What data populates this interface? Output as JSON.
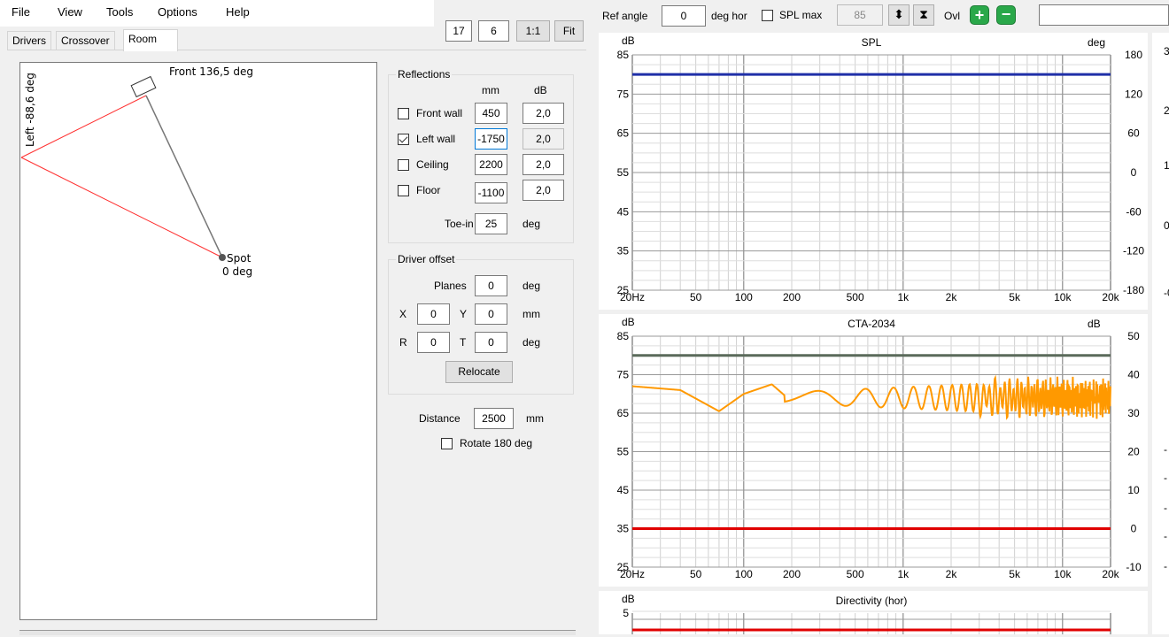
{
  "menu": [
    "File",
    "View",
    "Tools",
    "Options",
    "Help"
  ],
  "tabs": [
    "Drivers",
    "Crossover",
    "Room"
  ],
  "zoom": {
    "a": "17",
    "b": "6",
    "one_to_one": "1:1",
    "fit": "Fit"
  },
  "toolbar": {
    "ref_angle_label": "Ref angle",
    "ref_angle_value": "0",
    "deg_hor_label": "deg hor",
    "spl_max_label": "SPL max",
    "spl_max_value": "85",
    "ovl_label": "Ovl",
    "plus_icon": "plus-icon",
    "minus_icon": "minus-icon"
  },
  "room": {
    "front_label": "Front 136,5 deg",
    "left_label": "Left -88,6 deg",
    "spot_label": "Spot",
    "spot_deg": "0 deg"
  },
  "reflections": {
    "title": "Reflections",
    "col_mm": "mm",
    "col_db": "dB",
    "rows": [
      {
        "label": "Front wall",
        "checked": false,
        "mm": "450",
        "db": "2,0"
      },
      {
        "label": "Left wall",
        "checked": true,
        "mm": "-1750",
        "db": "2,0"
      },
      {
        "label": "Ceiling",
        "checked": false,
        "mm": "2200",
        "db": "2,0"
      },
      {
        "label": "Floor",
        "checked": false,
        "mm": "-1100",
        "db": "2,0"
      }
    ],
    "toe_in_label": "Toe-in",
    "toe_in_value": "25",
    "toe_in_unit": "deg"
  },
  "driver_offset": {
    "title": "Driver offset",
    "planes_label": "Planes",
    "planes_value": "0",
    "planes_unit": "deg",
    "x_label": "X",
    "x_value": "0",
    "y_label": "Y",
    "y_value": "0",
    "xy_unit": "mm",
    "r_label": "R",
    "r_value": "0",
    "t_label": "T",
    "t_value": "0",
    "rt_unit": "deg",
    "relocate_label": "Relocate"
  },
  "distance": {
    "label": "Distance",
    "value": "2500",
    "unit": "mm",
    "rotate_label": "Rotate 180 deg",
    "rotate_checked": false
  },
  "chart_data": [
    {
      "type": "line",
      "title": "SPL",
      "xlabel": "",
      "ylabel": "dB",
      "y2label": "deg",
      "x_scale": "log",
      "xlim": [
        20,
        20000
      ],
      "ylim": [
        25,
        85
      ],
      "y2lim": [
        -180,
        180
      ],
      "x_ticks": [
        "20Hz",
        "50",
        "100",
        "200",
        "500",
        "1k",
        "2k",
        "5k",
        "10k",
        "20k"
      ],
      "y_ticks": [
        "85",
        "75",
        "65",
        "55",
        "45",
        "35",
        "25"
      ],
      "y2_ticks": [
        "180",
        "120",
        "60",
        "0",
        "-60",
        "-120",
        "-180"
      ],
      "series": [
        {
          "color": "#1f2fa8",
          "x": [
            20,
            20000
          ],
          "y": [
            80,
            80
          ]
        }
      ]
    },
    {
      "type": "line",
      "title": "CTA-2034",
      "xlabel": "",
      "ylabel": "dB",
      "y2label": "dB",
      "x_scale": "log",
      "xlim": [
        20,
        20000
      ],
      "ylim": [
        25,
        85
      ],
      "y2lim": [
        -10,
        50
      ],
      "x_ticks": [
        "20Hz",
        "50",
        "100",
        "200",
        "500",
        "1k",
        "2k",
        "5k",
        "10k",
        "20k"
      ],
      "y_ticks": [
        "85",
        "75",
        "65",
        "55",
        "45",
        "35",
        "25"
      ],
      "y2_ticks": [
        "50",
        "40",
        "30",
        "20",
        "10",
        "0",
        "-10"
      ],
      "series": [
        {
          "color": "#5a6a5a",
          "x": [
            20,
            20000
          ],
          "y": [
            80,
            80
          ]
        },
        {
          "color": "#e00000",
          "x": [
            20,
            20000
          ],
          "y": [
            35,
            35
          ]
        },
        {
          "color": "#ff9900",
          "x": [
            20,
            40,
            70,
            100,
            150,
            200,
            300,
            500,
            1000,
            3000,
            10000,
            20000
          ],
          "y": [
            72,
            71,
            65.5,
            70,
            72.5,
            68,
            72,
            70,
            71,
            72,
            71,
            69
          ],
          "ripple": true
        }
      ]
    },
    {
      "type": "line",
      "title": "Directivity (hor)",
      "xlabel": "",
      "ylabel": "dB",
      "x_scale": "log",
      "xlim": [
        20,
        20000
      ],
      "y_ticks": [
        "5"
      ],
      "series": [
        {
          "color": "#e00000",
          "x": [
            20,
            20000
          ],
          "y": [
            4.3,
            4.3
          ]
        }
      ]
    }
  ],
  "right_axis_partial": [
    "3",
    "2",
    "1",
    "0",
    "-0",
    "-",
    "-",
    "-",
    "-",
    "-"
  ]
}
